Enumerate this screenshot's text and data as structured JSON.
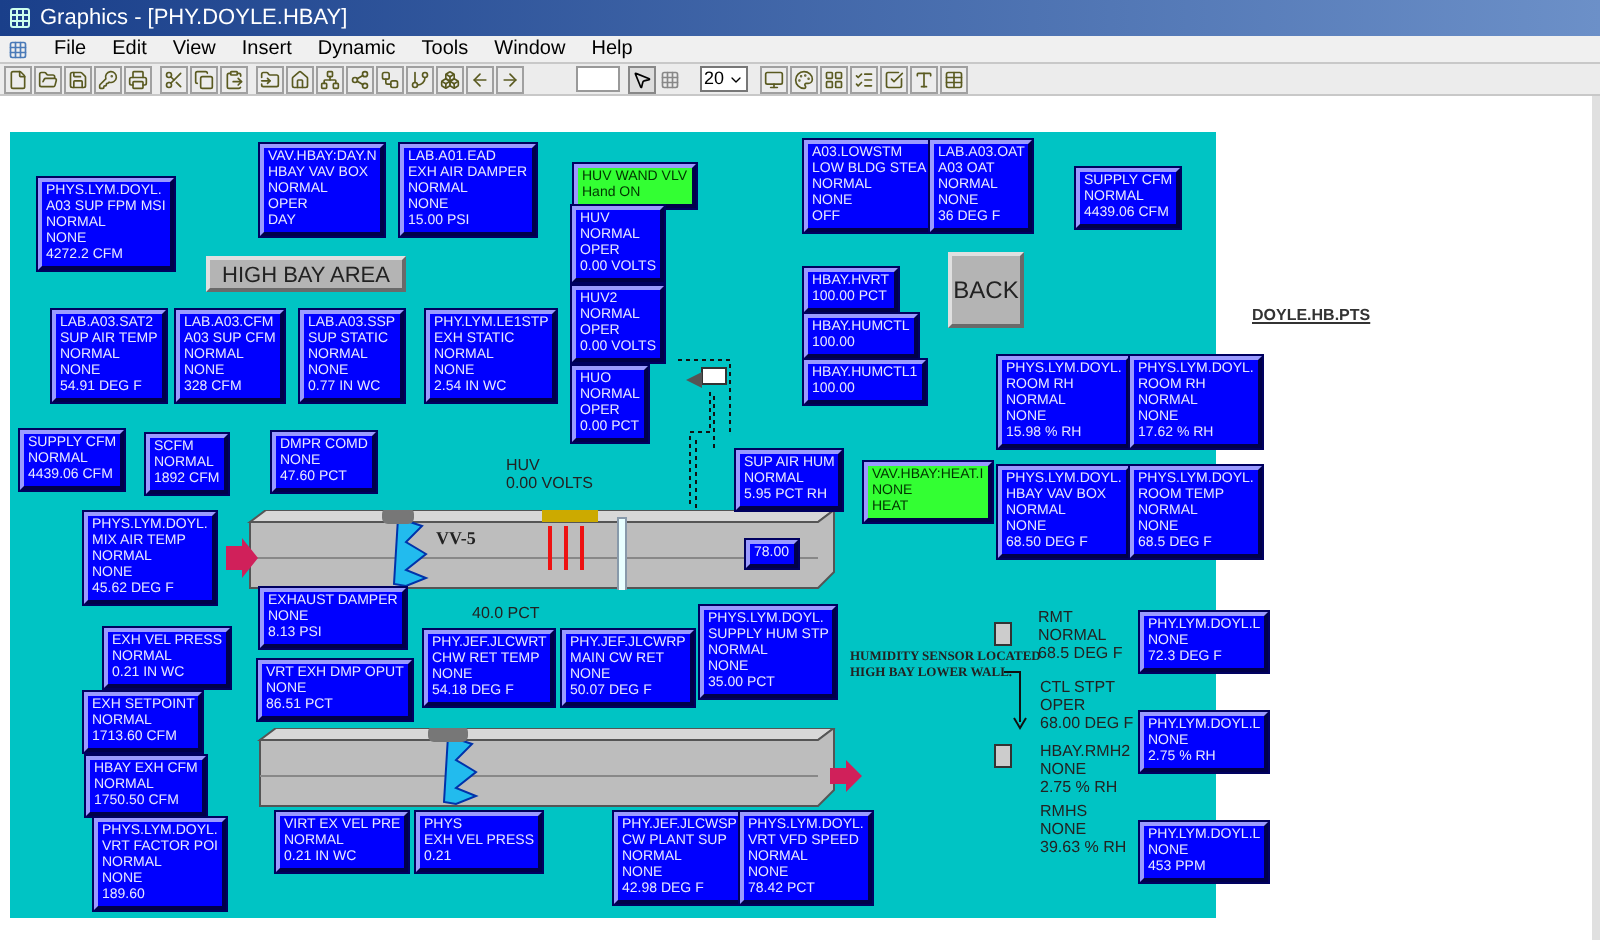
{
  "window": {
    "title": "Graphics - [PHY.DOYLE.HBAY]"
  },
  "menu": [
    "File",
    "Edit",
    "View",
    "Insert",
    "Dynamic",
    "Tools",
    "Window",
    "Help"
  ],
  "toolbar": {
    "font_size": "20"
  },
  "canvas": {
    "area_button": "HIGH BAY AREA",
    "back_button": "BACK",
    "link": "DOYLE.HB.PTS",
    "points": [
      {
        "color": "#0000ff",
        "lines": [
          "PHYS.LYM.DOYL.",
          "A03 SUP FPM MSI",
          "NORMAL",
          "NONE",
          "4272.2 CFM"
        ]
      },
      {
        "color": "#0000ff",
        "lines": [
          "VAV.HBAY:DAY.N",
          "HBAY VAV BOX",
          "NORMAL",
          "OPER",
          "DAY"
        ]
      },
      {
        "color": "#0000ff",
        "lines": [
          "LAB.A01.EAD",
          "EXH AIR DAMPER",
          "NORMAL",
          "NONE",
          "15.00 PSI"
        ]
      },
      {
        "color": "#0000ff",
        "lines": [
          "LAB.A03.SAT2",
          "SUP AIR TEMP",
          "NORMAL",
          "NONE",
          "54.91 DEG F"
        ]
      },
      {
        "color": "#0000ff",
        "lines": [
          "LAB.A03.CFM",
          "A03 SUP CFM",
          "NORMAL",
          "NONE",
          "328 CFM"
        ]
      },
      {
        "color": "#0000ff",
        "lines": [
          "LAB.A03.SSP",
          "SUP STATIC",
          "NORMAL",
          "NONE",
          "0.77 IN WC"
        ]
      },
      {
        "color": "#0000ff",
        "lines": [
          "PHY.LYM.LE1STP",
          "EXH STATIC",
          "NORMAL",
          "NONE",
          "2.54 IN WC"
        ]
      },
      {
        "color": "#0000ff",
        "lines": [
          "SUPPLY CFM",
          "NORMAL",
          "4439.06 CFM"
        ]
      },
      {
        "color": "#0000ff",
        "lines": [
          "SCFM",
          "NORMAL",
          "1892 CFM"
        ]
      },
      {
        "color": "#0000ff",
        "lines": [
          "DMPR COMD",
          "NONE",
          "47.60 PCT"
        ]
      },
      {
        "color": "#0000ff",
        "lines": [
          "PHYS.LYM.DOYL.",
          "MIX AIR TEMP",
          "NORMAL",
          "NONE",
          "45.62 DEG F"
        ]
      },
      {
        "color": "#33ff33",
        "lines": [
          "HUV WAND VLV",
          "Hand ON"
        ]
      },
      {
        "color": "#0000ff",
        "lines": [
          "HUV",
          "NORMAL",
          "OPER",
          "0.00 VOLTS"
        ]
      },
      {
        "color": "#0000ff",
        "lines": [
          "HUV2",
          "NORMAL",
          "OPER",
          "0.00 VOLTS"
        ]
      },
      {
        "color": "#0000ff",
        "lines": [
          "HUO",
          "NORMAL",
          "OPER",
          "0.00 PCT"
        ]
      },
      {
        "color": "#0000ff",
        "lines": [
          "A03.LOWSTM",
          "LOW BLDG STEA",
          "NORMAL",
          "NONE",
          "OFF"
        ]
      },
      {
        "color": "#0000ff",
        "lines": [
          "LAB.A03.OAT",
          "A03 OAT",
          "NORMAL",
          "NONE",
          "36 DEG F"
        ]
      },
      {
        "color": "#0000ff",
        "lines": [
          "SUPPLY CFM",
          "NORMAL",
          "4439.06 CFM"
        ]
      },
      {
        "color": "#0000ff",
        "lines": [
          "HBAY.HVRT",
          "100.00 PCT"
        ]
      },
      {
        "color": "#0000ff",
        "lines": [
          "HBAY.HUMCTL",
          "100.00"
        ]
      },
      {
        "color": "#0000ff",
        "lines": [
          "HBAY.HUMCTL1",
          "100.00"
        ]
      },
      {
        "color": "#0000ff",
        "lines": [
          "SUP AIR HUM",
          "NORMAL",
          "5.95 PCT RH"
        ]
      },
      {
        "color": "#0000ff",
        "lines": [
          "78.00"
        ]
      },
      {
        "color": "#33ff33",
        "lines": [
          "VAV.HBAY:HEAT.I",
          "NONE",
          "HEAT"
        ]
      },
      {
        "color": "#0000ff",
        "lines": [
          "PHYS.LYM.DOYL.",
          "ROOM RH",
          "NORMAL",
          "NONE",
          "15.98 % RH"
        ]
      },
      {
        "color": "#0000ff",
        "lines": [
          "PHYS.LYM.DOYL.",
          "ROOM RH",
          "NORMAL",
          "NONE",
          "17.62 % RH"
        ]
      },
      {
        "color": "#0000ff",
        "lines": [
          "PHYS.LYM.DOYL.",
          "HBAY VAV BOX",
          "NORMAL",
          "NONE",
          "68.50 DEG F"
        ]
      },
      {
        "color": "#0000ff",
        "lines": [
          "PHYS.LYM.DOYL.",
          "ROOM TEMP",
          "NORMAL",
          "NONE",
          "68.5 DEG F"
        ]
      },
      {
        "color": "#0000ff",
        "lines": [
          "EXHAUST  DAMPER",
          "NONE",
          "8.13 PSI"
        ]
      },
      {
        "color": "#0000ff",
        "lines": [
          "EXH VEL PRESS",
          "NORMAL",
          "0.21 IN WC"
        ]
      },
      {
        "color": "#0000ff",
        "lines": [
          "EXH SETPOINT",
          "NORMAL",
          "1713.60 CFM"
        ]
      },
      {
        "color": "#0000ff",
        "lines": [
          "VRT EXH DMP OPUT",
          "NONE",
          "86.51 PCT"
        ]
      },
      {
        "color": "#0000ff",
        "lines": [
          "PHY.JEF.JLCWRT",
          "CHW RET TEMP",
          "NONE",
          "54.18 DEG F"
        ]
      },
      {
        "color": "#0000ff",
        "lines": [
          "PHY.JEF.JLCWRP",
          "MAIN CW RET",
          "NONE",
          "50.07 DEG F"
        ]
      },
      {
        "color": "#0000ff",
        "lines": [
          "PHYS.LYM.DOYL.",
          "SUPPLY HUM STP",
          "NORMAL",
          "NONE",
          "35.00 PCT"
        ]
      },
      {
        "color": "#0000ff",
        "lines": [
          "HBAY EXH CFM",
          "NORMAL",
          "1750.50 CFM"
        ]
      },
      {
        "color": "#0000ff",
        "lines": [
          "PHYS.LYM.DOYL.",
          "VRT FACTOR POI",
          "NORMAL",
          "NONE",
          "189.60"
        ]
      },
      {
        "color": "#0000ff",
        "lines": [
          "VIRT EX VEL PRE",
          "NORMAL",
          "0.21 IN WC"
        ]
      },
      {
        "color": "#0000ff",
        "lines": [
          "PHYS",
          "EXH VEL PRESS",
          "0.21"
        ]
      },
      {
        "color": "#0000ff",
        "lines": [
          "PHY.JEF.JLCWSP",
          "CW PLANT SUP",
          "NORMAL",
          "NONE",
          "42.98 DEG F"
        ]
      },
      {
        "color": "#0000ff",
        "lines": [
          "PHYS.LYM.DOYL.",
          "VRT VFD SPEED",
          "NORMAL",
          "NONE",
          "78.42 PCT"
        ]
      },
      {
        "color": "#0000ff",
        "lines": [
          "PHY.LYM.DOYL.L",
          "NONE",
          "72.3 DEG F"
        ]
      },
      {
        "color": "#0000ff",
        "lines": [
          "PHY.LYM.DOYL.L",
          "NONE",
          "2.75 % RH"
        ]
      },
      {
        "color": "#0000ff",
        "lines": [
          "PHY.LYM.DOYL.L",
          "NONE",
          "453 PPM"
        ]
      }
    ],
    "readings": [
      {
        "lines": [
          "HUV",
          "0.00 VOLTS"
        ]
      },
      {
        "lines": [
          "40.0 PCT"
        ]
      },
      {
        "lines": [
          "RMT",
          "NORMAL",
          "68.5 DEG F"
        ]
      },
      {
        "lines": [
          "CTL STPT",
          "OPER",
          "68.00 DEG F"
        ]
      },
      {
        "lines": [
          "HBAY.RMH2",
          "NONE",
          "2.75 % RH"
        ]
      },
      {
        "lines": [
          "RMHS",
          "NONE",
          "39.63 % RH"
        ]
      }
    ],
    "duct_label": "VV-5",
    "note": [
      "HUMIDITY SENSOR LOCATED",
      "HIGH BAY LOWER WALL."
    ]
  }
}
